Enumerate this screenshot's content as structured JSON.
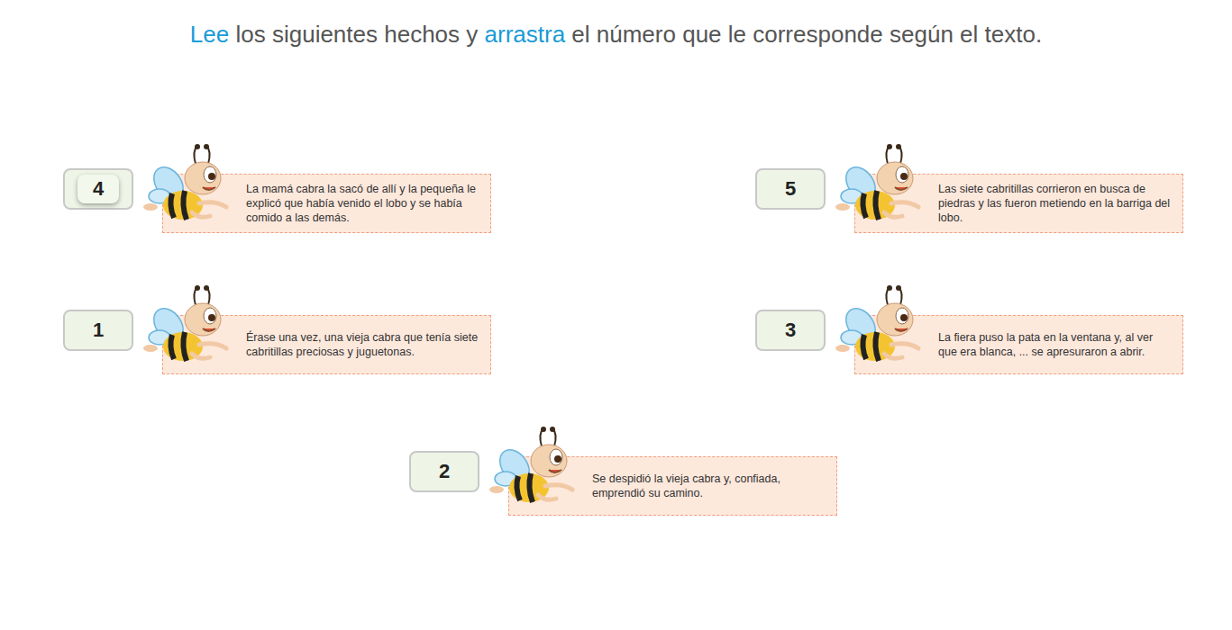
{
  "instruction": [
    {
      "text": "Lee",
      "highlight": true
    },
    {
      "text": " los siguientes hechos y ",
      "highlight": false
    },
    {
      "text": "arrastra",
      "highlight": true
    },
    {
      "text": " el número que le corresponde según el texto.",
      "highlight": false
    }
  ],
  "items": [
    {
      "number": "4",
      "dragging": true,
      "text": "La mamá cabra la sacó de allí y la pequeña le explicó que había venido el lobo y se había comido a las demás."
    },
    {
      "number": "5",
      "dragging": false,
      "text": "Las siete cabritillas corrieron en busca de piedras y las fueron metiendo en la barriga del lobo."
    },
    {
      "number": "1",
      "dragging": false,
      "text": "Érase una vez, una vieja cabra que tenía siete cabritillas preciosas y juguetonas."
    },
    {
      "number": "3",
      "dragging": false,
      "text": "La fiera puso la pata en la ventana y, al ver que era blanca, ... se apresuraron a abrir."
    },
    {
      "number": "2",
      "dragging": false,
      "text": "Se despidió la vieja cabra y, confiada, emprendió su camino."
    }
  ]
}
